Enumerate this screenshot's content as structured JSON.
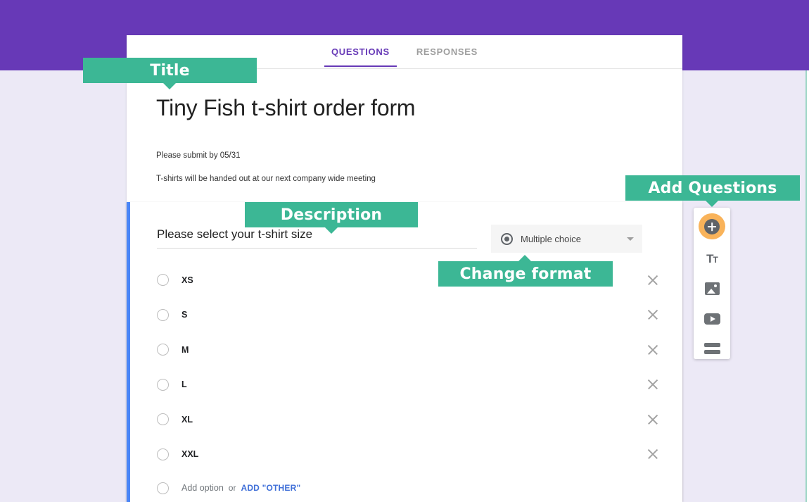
{
  "theme": {
    "header_purple": "#6739b7",
    "page_background": "#ece9f6",
    "callout_green": "#3cb795",
    "accent_blue": "#4a86f7",
    "add_button_orange": "#f9b35a",
    "link_blue": "#3f6fd8"
  },
  "tabs": [
    {
      "label": "QUESTIONS",
      "active": true
    },
    {
      "label": "RESPONSES",
      "active": false
    }
  ],
  "form": {
    "title": "Tiny Fish t-shirt order form",
    "description_line_1": "Please submit by 05/31",
    "description_line_2": "T-shirts will be handed out at our next company wide meeting"
  },
  "question": {
    "text": "Please select your t-shirt size",
    "format": {
      "label": "Multiple choice",
      "icon": "radio-filled-icon",
      "caret": "chevron-down-icon"
    },
    "options": [
      {
        "label": "XS"
      },
      {
        "label": "S"
      },
      {
        "label": "M"
      },
      {
        "label": "L"
      },
      {
        "label": "XL"
      },
      {
        "label": "XXL"
      }
    ],
    "add_option": {
      "add_text": "Add option",
      "or_text": "or",
      "add_other_label": "ADD \"OTHER\""
    },
    "remove_icon": "close-icon"
  },
  "toolbar": {
    "items": [
      {
        "name": "add-question-button",
        "icon": "plus-circle-icon",
        "label": ""
      },
      {
        "name": "add-title-button",
        "icon": "title-text-icon",
        "label": "Tt"
      },
      {
        "name": "add-image-button",
        "icon": "image-icon",
        "label": ""
      },
      {
        "name": "add-video-button",
        "icon": "video-icon",
        "label": ""
      },
      {
        "name": "add-section-button",
        "icon": "section-icon",
        "label": ""
      }
    ]
  },
  "callouts": {
    "title": "Title",
    "description": "Description",
    "change_format": "Change format",
    "add_questions": "Add Questions"
  }
}
